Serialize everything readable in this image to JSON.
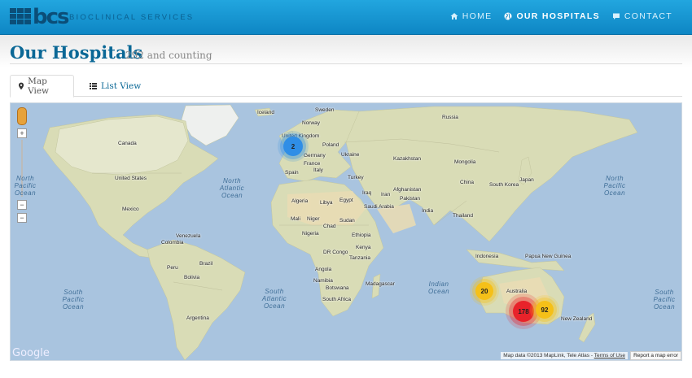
{
  "header": {
    "logo_text": "bcs",
    "logo_subtitle": "BIOCLINICAL SERVICES",
    "nav": [
      {
        "label": "HOME",
        "icon": "home-icon"
      },
      {
        "label": "OUR HOSPITALS",
        "icon": "globe-icon",
        "active": true
      },
      {
        "label": "CONTACT",
        "icon": "chat-bubble-icon"
      }
    ]
  },
  "page": {
    "title": "Our Hospitals",
    "subtitle": "292 and counting"
  },
  "tabs": [
    {
      "label": "Map View",
      "icon": "map-marker-icon",
      "active": true
    },
    {
      "label": "List View",
      "icon": "list-icon",
      "active": false
    }
  ],
  "map": {
    "countries": [
      "Iceland",
      "Sweden",
      "Norway",
      "Russia",
      "United Kingdom",
      "Poland",
      "Germany",
      "Ukraine",
      "France",
      "Italy",
      "Kazakhstan",
      "Mongolia",
      "Spain",
      "Turkey",
      "China",
      "Japan",
      "South Korea",
      "Algeria",
      "Libya",
      "Egypt",
      "Iraq",
      "Iran",
      "Afghanistan",
      "Pakistan",
      "Saudi Arabia",
      "India",
      "Mali",
      "Niger",
      "Chad",
      "Sudan",
      "Thailand",
      "Nigeria",
      "Ethiopia",
      "Kenya",
      "DR Congo",
      "Tanzania",
      "Indonesia",
      "Papua New Guinea",
      "Angola",
      "Namibia",
      "Botswana",
      "Madagascar",
      "South Africa",
      "Australia",
      "New Zealand",
      "Canada",
      "United States",
      "Mexico",
      "Venezuela",
      "Colombia",
      "Peru",
      "Brazil",
      "Bolivia",
      "Argentina"
    ],
    "oceans": {
      "north_pacific_left": "North Pacific Ocean",
      "north_atlantic": "North Atlantic Ocean",
      "north_pacific_right": "North Pacific Ocean",
      "south_pacific_left": "South Pacific Ocean",
      "south_atlantic": "South Atlantic Ocean",
      "indian": "Indian Ocean",
      "south_pacific_right": "South Pacific Ocean"
    },
    "clusters": [
      {
        "name": "europe-uk",
        "count": "2",
        "color": "#2f8ee6"
      },
      {
        "name": "western-australia",
        "count": "20",
        "color": "#f5c018"
      },
      {
        "name": "south-australia",
        "count": "178",
        "color": "#e8232a"
      },
      {
        "name": "east-australia",
        "count": "92",
        "color": "#f5c018"
      }
    ],
    "zoom_in": "+",
    "zoom_out": "−",
    "zoom_extra": "−",
    "provider": "Google",
    "attribution": "Map data ©2013 MapLink, Tele Atlas - ",
    "terms": "Terms of Use",
    "report": "Report a map error"
  }
}
